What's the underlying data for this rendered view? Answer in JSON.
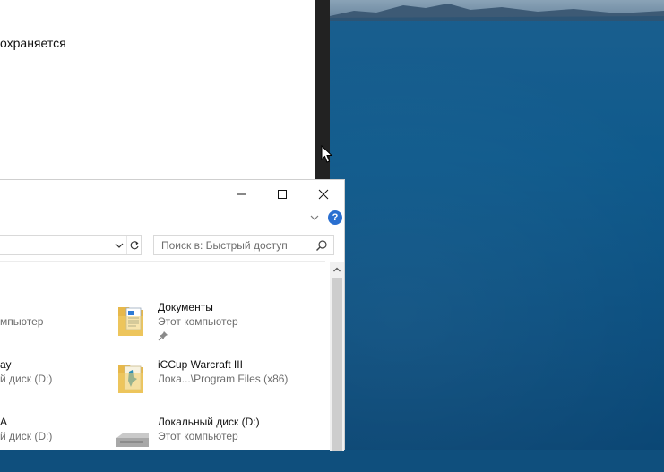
{
  "top_window": {
    "text": "охраняется"
  },
  "explorer": {
    "title_buttons": {
      "minimize": "minimize",
      "maximize": "maximize",
      "close": "close"
    },
    "help_label": "?",
    "search": {
      "placeholder": "Поиск в: Быстрый доступ"
    },
    "left_items": [
      {
        "name": "",
        "sub": "мпьютер"
      },
      {
        "name": "ау",
        "sub": "й диск (D:)"
      },
      {
        "name": "A",
        "sub": "й диск (D:)"
      }
    ],
    "items": [
      {
        "name": "Документы",
        "sub": "Этот компьютер",
        "icon": "documents-folder-icon",
        "pinned": true
      },
      {
        "name": "iCCup Warcraft III",
        "sub": "Лока...\\Program Files (x86)",
        "icon": "warcraft-folder-icon",
        "pinned": false
      },
      {
        "name": "Локальный диск (D:)",
        "sub": "Этот компьютер",
        "icon": "local-disk-icon",
        "pinned": false
      }
    ]
  },
  "colors": {
    "desktop_blue": "#0f5a8c",
    "help_blue": "#2a6fd0",
    "folder_yellow": "#f2cf6b"
  }
}
